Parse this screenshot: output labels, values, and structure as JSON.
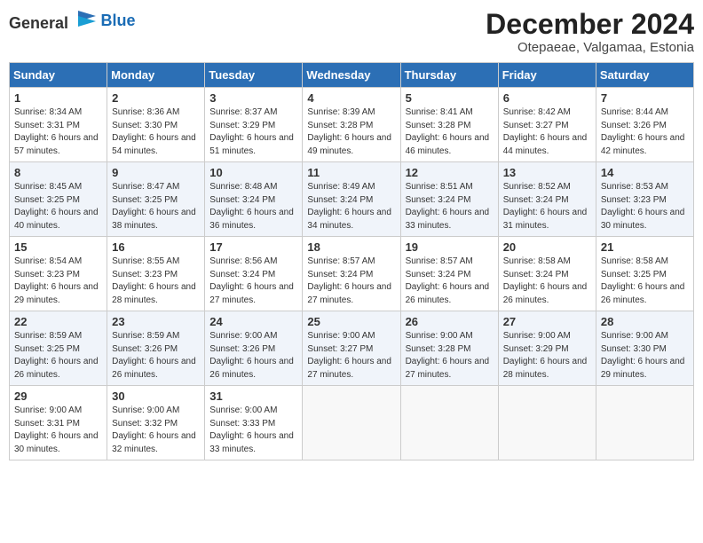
{
  "header": {
    "logo_general": "General",
    "logo_blue": "Blue",
    "month_title": "December 2024",
    "subtitle": "Otepaeae, Valgamaa, Estonia"
  },
  "weekdays": [
    "Sunday",
    "Monday",
    "Tuesday",
    "Wednesday",
    "Thursday",
    "Friday",
    "Saturday"
  ],
  "weeks": [
    [
      {
        "day": "1",
        "sunrise": "8:34 AM",
        "sunset": "3:31 PM",
        "daylight": "6 hours and 57 minutes."
      },
      {
        "day": "2",
        "sunrise": "8:36 AM",
        "sunset": "3:30 PM",
        "daylight": "6 hours and 54 minutes."
      },
      {
        "day": "3",
        "sunrise": "8:37 AM",
        "sunset": "3:29 PM",
        "daylight": "6 hours and 51 minutes."
      },
      {
        "day": "4",
        "sunrise": "8:39 AM",
        "sunset": "3:28 PM",
        "daylight": "6 hours and 49 minutes."
      },
      {
        "day": "5",
        "sunrise": "8:41 AM",
        "sunset": "3:28 PM",
        "daylight": "6 hours and 46 minutes."
      },
      {
        "day": "6",
        "sunrise": "8:42 AM",
        "sunset": "3:27 PM",
        "daylight": "6 hours and 44 minutes."
      },
      {
        "day": "7",
        "sunrise": "8:44 AM",
        "sunset": "3:26 PM",
        "daylight": "6 hours and 42 minutes."
      }
    ],
    [
      {
        "day": "8",
        "sunrise": "8:45 AM",
        "sunset": "3:25 PM",
        "daylight": "6 hours and 40 minutes."
      },
      {
        "day": "9",
        "sunrise": "8:47 AM",
        "sunset": "3:25 PM",
        "daylight": "6 hours and 38 minutes."
      },
      {
        "day": "10",
        "sunrise": "8:48 AM",
        "sunset": "3:24 PM",
        "daylight": "6 hours and 36 minutes."
      },
      {
        "day": "11",
        "sunrise": "8:49 AM",
        "sunset": "3:24 PM",
        "daylight": "6 hours and 34 minutes."
      },
      {
        "day": "12",
        "sunrise": "8:51 AM",
        "sunset": "3:24 PM",
        "daylight": "6 hours and 33 minutes."
      },
      {
        "day": "13",
        "sunrise": "8:52 AM",
        "sunset": "3:24 PM",
        "daylight": "6 hours and 31 minutes."
      },
      {
        "day": "14",
        "sunrise": "8:53 AM",
        "sunset": "3:23 PM",
        "daylight": "6 hours and 30 minutes."
      }
    ],
    [
      {
        "day": "15",
        "sunrise": "8:54 AM",
        "sunset": "3:23 PM",
        "daylight": "6 hours and 29 minutes."
      },
      {
        "day": "16",
        "sunrise": "8:55 AM",
        "sunset": "3:23 PM",
        "daylight": "6 hours and 28 minutes."
      },
      {
        "day": "17",
        "sunrise": "8:56 AM",
        "sunset": "3:24 PM",
        "daylight": "6 hours and 27 minutes."
      },
      {
        "day": "18",
        "sunrise": "8:57 AM",
        "sunset": "3:24 PM",
        "daylight": "6 hours and 27 minutes."
      },
      {
        "day": "19",
        "sunrise": "8:57 AM",
        "sunset": "3:24 PM",
        "daylight": "6 hours and 26 minutes."
      },
      {
        "day": "20",
        "sunrise": "8:58 AM",
        "sunset": "3:24 PM",
        "daylight": "6 hours and 26 minutes."
      },
      {
        "day": "21",
        "sunrise": "8:58 AM",
        "sunset": "3:25 PM",
        "daylight": "6 hours and 26 minutes."
      }
    ],
    [
      {
        "day": "22",
        "sunrise": "8:59 AM",
        "sunset": "3:25 PM",
        "daylight": "6 hours and 26 minutes."
      },
      {
        "day": "23",
        "sunrise": "8:59 AM",
        "sunset": "3:26 PM",
        "daylight": "6 hours and 26 minutes."
      },
      {
        "day": "24",
        "sunrise": "9:00 AM",
        "sunset": "3:26 PM",
        "daylight": "6 hours and 26 minutes."
      },
      {
        "day": "25",
        "sunrise": "9:00 AM",
        "sunset": "3:27 PM",
        "daylight": "6 hours and 27 minutes."
      },
      {
        "day": "26",
        "sunrise": "9:00 AM",
        "sunset": "3:28 PM",
        "daylight": "6 hours and 27 minutes."
      },
      {
        "day": "27",
        "sunrise": "9:00 AM",
        "sunset": "3:29 PM",
        "daylight": "6 hours and 28 minutes."
      },
      {
        "day": "28",
        "sunrise": "9:00 AM",
        "sunset": "3:30 PM",
        "daylight": "6 hours and 29 minutes."
      }
    ],
    [
      {
        "day": "29",
        "sunrise": "9:00 AM",
        "sunset": "3:31 PM",
        "daylight": "6 hours and 30 minutes."
      },
      {
        "day": "30",
        "sunrise": "9:00 AM",
        "sunset": "3:32 PM",
        "daylight": "6 hours and 32 minutes."
      },
      {
        "day": "31",
        "sunrise": "9:00 AM",
        "sunset": "3:33 PM",
        "daylight": "6 hours and 33 minutes."
      },
      null,
      null,
      null,
      null
    ]
  ]
}
